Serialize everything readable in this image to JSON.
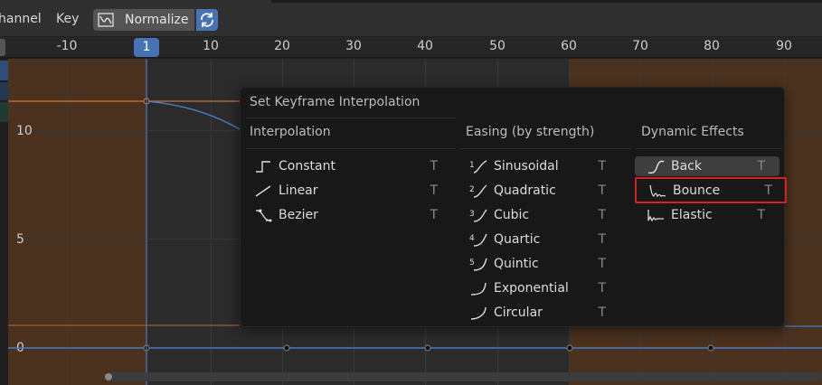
{
  "header": {
    "menu": [
      "hannel",
      "Key"
    ],
    "normalize_label": "Normalize"
  },
  "ruler": {
    "current_frame": "1",
    "ticks": [
      "-10",
      "10",
      "20",
      "30",
      "40",
      "50",
      "60",
      "70",
      "80",
      "90"
    ]
  },
  "graph": {
    "y_labels": [
      "10",
      "5",
      "0"
    ]
  },
  "popup": {
    "title": "Set Keyframe Interpolation",
    "columns": [
      {
        "heading": "Interpolation",
        "items": [
          {
            "label": "Constant",
            "shortcut": "T",
            "icon": "ipo-constant-icon"
          },
          {
            "label": "Linear",
            "shortcut": "T",
            "icon": "ipo-linear-icon"
          },
          {
            "label": "Bezier",
            "shortcut": "T",
            "icon": "ipo-bezier-icon"
          }
        ]
      },
      {
        "heading": "Easing (by strength)",
        "items": [
          {
            "label": "Sinusoidal",
            "shortcut": "T",
            "icon": "ipo-sine-icon",
            "num": "1"
          },
          {
            "label": "Quadratic",
            "shortcut": "T",
            "icon": "ipo-quad-icon",
            "num": "2"
          },
          {
            "label": "Cubic",
            "shortcut": "T",
            "icon": "ipo-cubic-icon",
            "num": "3"
          },
          {
            "label": "Quartic",
            "shortcut": "T",
            "icon": "ipo-quart-icon",
            "num": "4"
          },
          {
            "label": "Quintic",
            "shortcut": "T",
            "icon": "ipo-quint-icon",
            "num": "5"
          },
          {
            "label": "Exponential",
            "shortcut": "T",
            "icon": "ipo-expo-icon"
          },
          {
            "label": "Circular",
            "shortcut": "T",
            "icon": "ipo-circ-icon"
          }
        ]
      },
      {
        "heading": "Dynamic Effects",
        "items": [
          {
            "label": "Back",
            "shortcut": "T",
            "icon": "ipo-back-icon"
          },
          {
            "label": "Bounce",
            "shortcut": "T",
            "icon": "ipo-bounce-icon"
          },
          {
            "label": "Elastic",
            "shortcut": "T",
            "icon": "ipo-elastic-icon"
          }
        ]
      }
    ]
  },
  "colors": {
    "accent": "#4772b3",
    "highlight_border": "#d61f1f",
    "out_of_range": "#4a321f",
    "curve": "#4a78c0",
    "orange_curve": "#c9733f"
  }
}
